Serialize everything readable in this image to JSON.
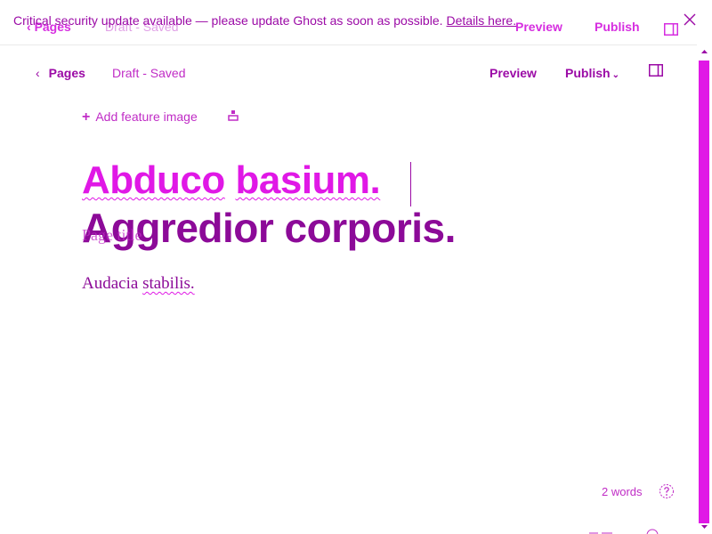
{
  "banner": {
    "message": "Critical security update available — please update Ghost as soon as possible.",
    "link_label": "Details here."
  },
  "ghost_header": {
    "back_label": "Pages",
    "status": "Draft - Saved",
    "preview_label": "Preview",
    "publish_label": "Publish"
  },
  "header": {
    "back_label": "Pages",
    "status": "Draft - Saved",
    "preview_label": "Preview",
    "publish_label": "Publish"
  },
  "editor": {
    "feature_image_label": "Add feature image",
    "title_word_1": "Abduco",
    "title_word_2": "basium.",
    "ghost_title": "Aggredior corporis.",
    "behind_text": "Page title",
    "body_word_1": "Audacia",
    "body_word_2": "stabilis."
  },
  "footer": {
    "word_count": "2 words"
  },
  "colors": {
    "accent": "#e018e6",
    "accent_dark": "#9b0aa6",
    "accent_mid": "#c02cc6",
    "ghost_title": "#8c0a98"
  },
  "icons": {
    "back": "chevron-left-icon",
    "publish": "chevron-down-icon",
    "settings": "sidebar-toggle-icon",
    "close": "close-icon",
    "feature": "plus-icon",
    "upload": "upload-icon",
    "help": "help-icon"
  }
}
